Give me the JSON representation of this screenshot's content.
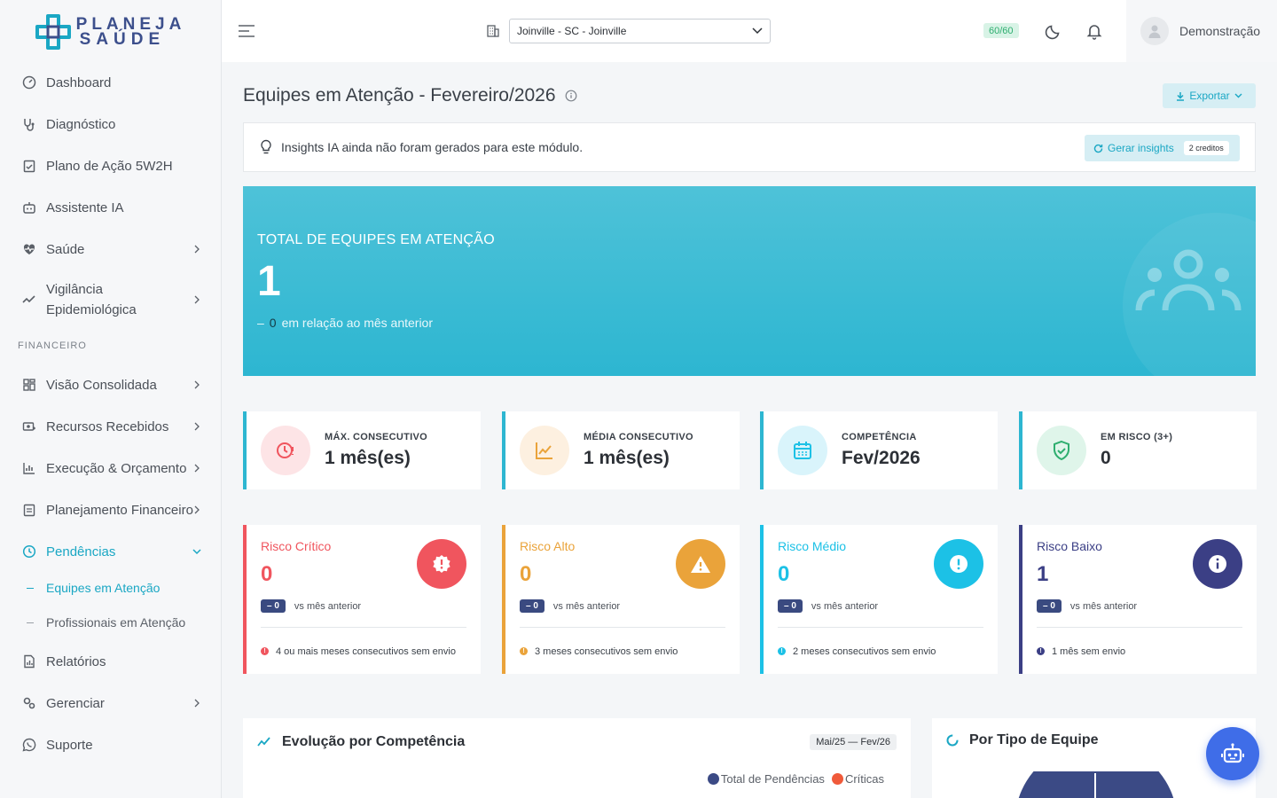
{
  "brand": {
    "line1": "PLANEJA",
    "line2": "SAÚDE"
  },
  "sidebar": {
    "items": [
      {
        "label": "Dashboard",
        "icon": "speedometer-icon"
      },
      {
        "label": "Diagnóstico",
        "icon": "stethoscope-icon"
      },
      {
        "label": "Plano de Ação 5W2H",
        "icon": "clipboard-check-icon"
      },
      {
        "label": "Assistente IA",
        "icon": "robot-icon"
      },
      {
        "label": "Saúde",
        "icon": "heart-pulse-icon"
      },
      {
        "label": "Vigilância Epidemiológica",
        "icon": "trend-icon"
      }
    ],
    "section_financeiro": "FINANCEIRO",
    "fin_items": [
      {
        "label": "Visão Consolidada",
        "icon": "dashboard-grid-icon"
      },
      {
        "label": "Recursos Recebidos",
        "icon": "money-icon"
      },
      {
        "label": "Execução & Orçamento",
        "icon": "chart-icon"
      },
      {
        "label": "Planejamento Financeiro",
        "icon": "clipboard-icon"
      },
      {
        "label": "Pendências",
        "icon": "clock-alert-icon"
      }
    ],
    "sub_items": [
      {
        "label": "Equipes em Atenção",
        "active": true
      },
      {
        "label": "Profissionais em Atenção",
        "active": false
      }
    ],
    "bottom_items": [
      {
        "label": "Relatórios",
        "icon": "report-icon"
      },
      {
        "label": "Gerenciar",
        "icon": "gears-icon"
      },
      {
        "label": "Suporte",
        "icon": "whatsapp-icon"
      }
    ]
  },
  "topbar": {
    "city": "Joinville - SC - Joinville",
    "quota": "60/60",
    "user": "Demonstração"
  },
  "page": {
    "title": "Equipes em Atenção - Fevereiro/2026",
    "export": "Exportar",
    "insights_text": "Insights IA ainda não foram gerados para este módulo.",
    "gen_insights": "Gerar insights",
    "credits": "2 creditos"
  },
  "hero": {
    "title": "TOTAL DE EQUIPES EM ATENÇÃO",
    "value": "1",
    "delta_sign": "–",
    "delta_value": "0",
    "delta_text": "em relação ao mês anterior"
  },
  "stats": [
    {
      "label": "MÁX. CONSECUTIVO",
      "value": "1 mês(es)"
    },
    {
      "label": "MÉDIA CONSECUTIVO",
      "value": "1 mês(es)"
    },
    {
      "label": "COMPETÊNCIA",
      "value": "Fev/2026"
    },
    {
      "label": "EM RISCO (3+)",
      "value": "0"
    }
  ],
  "risks": [
    {
      "name": "Risco Crítico",
      "value": "0",
      "pill": "– 0",
      "cmp": "vs mês anterior",
      "note": "4 ou mais meses consecutivos sem envio",
      "color": "#f0555e"
    },
    {
      "name": "Risco Alto",
      "value": "0",
      "pill": "– 0",
      "cmp": "vs mês anterior",
      "note": "3 meses consecutivos sem envio",
      "color": "#eaa33a"
    },
    {
      "name": "Risco Médio",
      "value": "0",
      "pill": "– 0",
      "cmp": "vs mês anterior",
      "note": "2 meses consecutivos sem envio",
      "color": "#1cc1e6"
    },
    {
      "name": "Risco Baixo",
      "value": "1",
      "pill": "– 0",
      "cmp": "vs mês anterior",
      "note": "1 mês sem envio",
      "color": "#3b3f85"
    }
  ],
  "panels": {
    "evolution": {
      "title": "Evolução por Competência",
      "range": "Mai/25 — Fev/26",
      "legend": [
        {
          "label": "Total de Pendências",
          "color": "#3b4a85"
        },
        {
          "label": "Críticas",
          "color": "#f05a3a"
        }
      ]
    },
    "by_type": {
      "title": "Por Tipo de Equipe"
    }
  }
}
